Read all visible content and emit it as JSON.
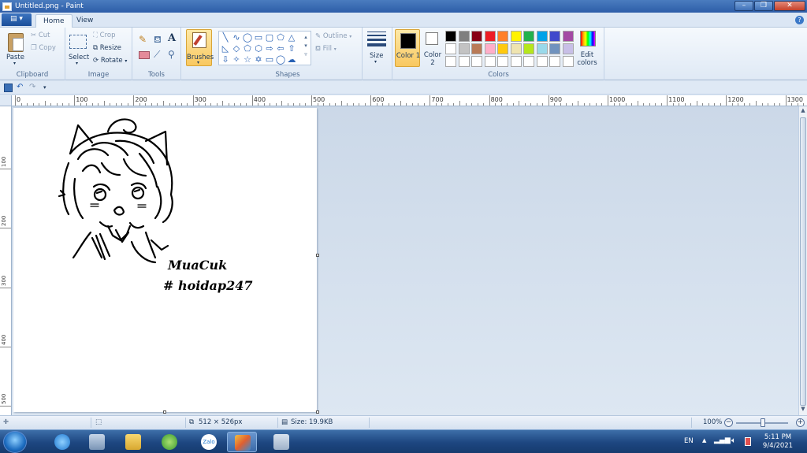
{
  "window": {
    "title": "Untitled.png - Paint"
  },
  "menu": {
    "file_label": "▤ ▾"
  },
  "tabs": [
    {
      "label": "Home"
    },
    {
      "label": "View"
    }
  ],
  "ribbon": {
    "clipboard": {
      "label": "Clipboard",
      "paste": "Paste",
      "cut": "Cut",
      "copy": "Copy"
    },
    "image": {
      "label": "Image",
      "select": "Select",
      "crop": "Crop",
      "resize": "Resize",
      "rotate": "Rotate"
    },
    "tools": {
      "label": "Tools"
    },
    "brushes": {
      "label": "Brushes"
    },
    "shapes": {
      "label": "Shapes",
      "outline": "Outline",
      "fill": "Fill"
    },
    "size": {
      "label": "Size"
    },
    "colors": {
      "label": "Colors",
      "color1_label": "Color 1",
      "color2_label": "Color 2",
      "edit_label": "Edit colors",
      "color1_value": "#000000",
      "color2_value": "#ffffff",
      "palette_row1": [
        "#000000",
        "#7f7f7f",
        "#880015",
        "#ed1c24",
        "#ff7f27",
        "#fff200",
        "#22b14c",
        "#00a2e8",
        "#3f48cc",
        "#a349a4"
      ],
      "palette_row2": [
        "#ffffff",
        "#c3c3c3",
        "#b97a57",
        "#ffaec9",
        "#ffc90e",
        "#efe4b0",
        "#b5e61d",
        "#99d9ea",
        "#7092be",
        "#c8bfe7"
      ],
      "palette_row3": [
        "#ffffff",
        "#ffffff",
        "#ffffff",
        "#ffffff",
        "#ffffff",
        "#ffffff",
        "#ffffff",
        "#ffffff",
        "#ffffff",
        "#ffffff"
      ]
    }
  },
  "ruler": {
    "h_labels": [
      "0",
      "100",
      "200",
      "300",
      "400",
      "500",
      "600",
      "700",
      "800",
      "900",
      "1000",
      "1100",
      "1200",
      "1300"
    ],
    "v_labels": [
      "100",
      "200",
      "300",
      "400",
      "500"
    ]
  },
  "canvas": {
    "drawing_text_1": "MuaCuk",
    "drawing_text_2": "# hoidap247"
  },
  "status": {
    "selection_size": "512 × 526px",
    "file_size": "Size: 19.9KB",
    "zoom": "100%",
    "zoom_level": 1.0
  },
  "taskbar": {
    "zalo_label": "Zalo",
    "language": "EN",
    "time": "5:11 PM",
    "date": "9/4/2021"
  }
}
